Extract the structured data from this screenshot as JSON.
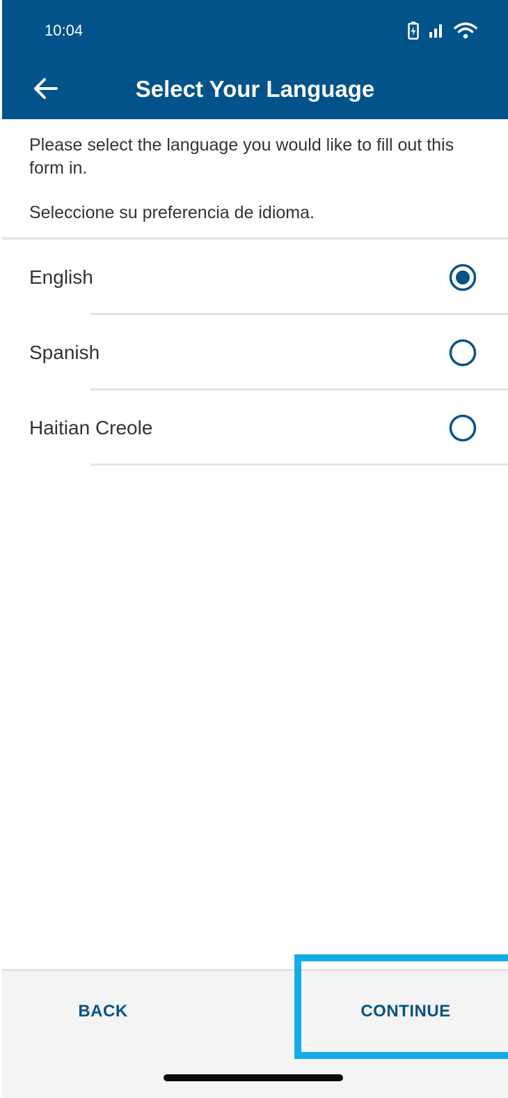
{
  "status_bar": {
    "time": "10:04",
    "icons": [
      "battery-charging-icon",
      "signal-icon",
      "wifi-icon"
    ]
  },
  "header": {
    "title": "Select Your Language",
    "back_icon": "arrow-left-icon"
  },
  "intro": {
    "english": "Please select the language you would like to fill out this form in.",
    "spanish": "Seleccione su preferencia de idioma."
  },
  "languages": [
    {
      "label": "English",
      "selected": true
    },
    {
      "label": "Spanish",
      "selected": false
    },
    {
      "label": "Haitian Creole",
      "selected": false
    }
  ],
  "footer": {
    "back_label": "BACK",
    "continue_label": "CONTINUE"
  },
  "colors": {
    "primary": "#025389",
    "highlight": "#14ACE8",
    "text": "#333333",
    "footer_bg": "#F4F4F4"
  }
}
